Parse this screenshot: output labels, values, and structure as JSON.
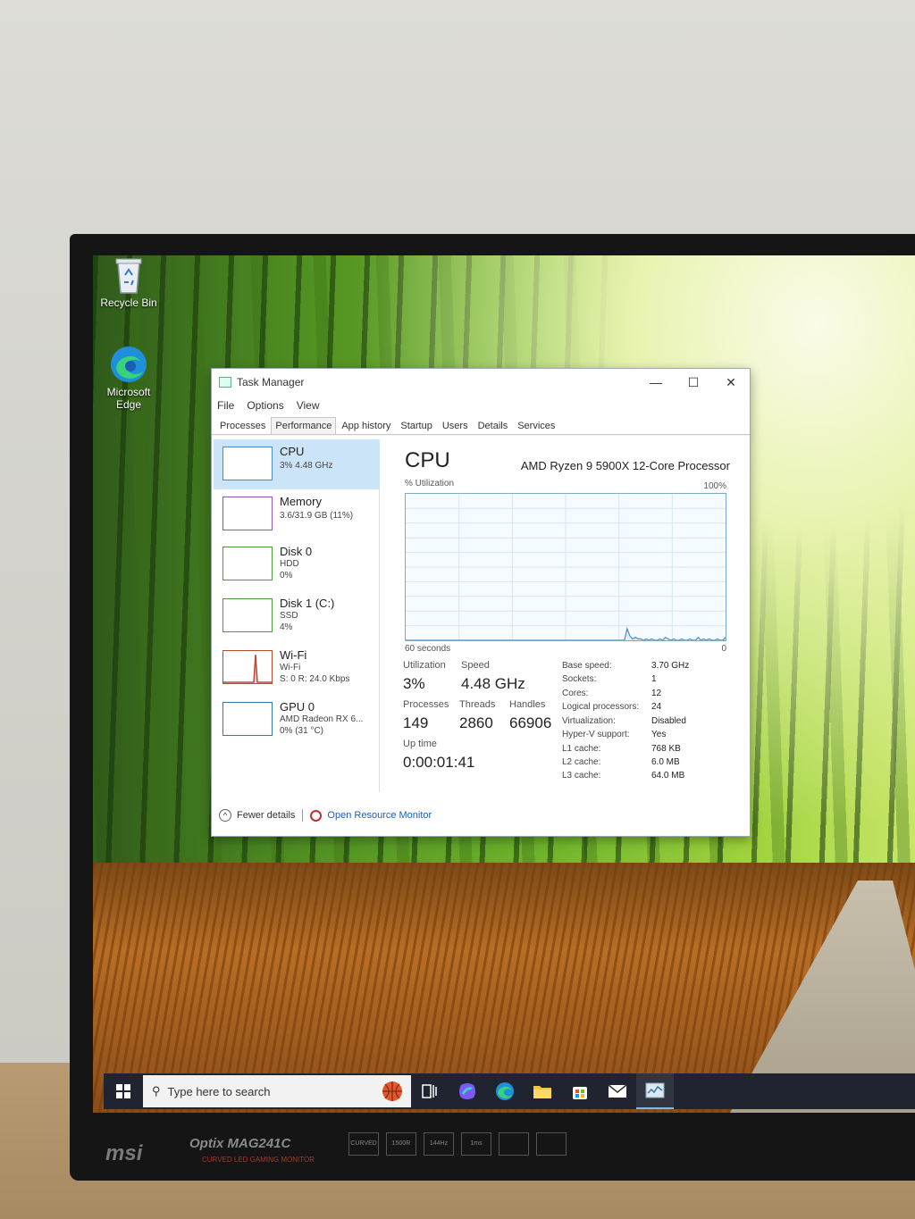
{
  "desktop": {
    "icons": [
      {
        "label": "Recycle Bin",
        "icon": "recycle-bin-icon"
      },
      {
        "label": "Microsoft Edge",
        "icon": "edge-icon"
      }
    ]
  },
  "window": {
    "title": "Task Manager",
    "controls": {
      "minimize": "—",
      "maximize": "☐",
      "close": "✕"
    }
  },
  "menu": [
    "File",
    "Options",
    "View"
  ],
  "tabs": [
    "Processes",
    "Performance",
    "App history",
    "Startup",
    "Users",
    "Details",
    "Services"
  ],
  "active_tab": "Performance",
  "sidebar": [
    {
      "name": "CPU",
      "line1": "3% 4.48 GHz",
      "line2": ""
    },
    {
      "name": "Memory",
      "line1": "3.6/31.9 GB (11%)",
      "line2": ""
    },
    {
      "name": "Disk 0",
      "line1": "HDD",
      "line2": "0%"
    },
    {
      "name": "Disk 1 (C:)",
      "line1": "SSD",
      "line2": "4%"
    },
    {
      "name": "Wi-Fi",
      "line1": "Wi-Fi",
      "line2": "S: 0 R: 24.0 Kbps"
    },
    {
      "name": "GPU 0",
      "line1": "AMD Radeon RX 6...",
      "line2": "0% (31 °C)"
    }
  ],
  "cpu": {
    "title": "CPU",
    "model": "AMD Ryzen 9 5900X 12-Core Processor",
    "util_label": "% Utilization",
    "util_max": "100%",
    "time_span": "60 seconds",
    "zero": "0",
    "graph_points": [
      0,
      0,
      0,
      0,
      0,
      0,
      0,
      0,
      0,
      0,
      0,
      0,
      0,
      0,
      0,
      0,
      0,
      0,
      0,
      0,
      0,
      0,
      0,
      0,
      0,
      0,
      0,
      0,
      0,
      0,
      0,
      0,
      0,
      0,
      0,
      0,
      0,
      0,
      0,
      0,
      0,
      0,
      0,
      0,
      0,
      0,
      0,
      0,
      0,
      0,
      0,
      0,
      0,
      0,
      0,
      0,
      0,
      0,
      0,
      0,
      0,
      0,
      0,
      0,
      0,
      0,
      0,
      0,
      0,
      0,
      0,
      0,
      0,
      0,
      0,
      0,
      0,
      0,
      0,
      0,
      0,
      8,
      3,
      1,
      2,
      1,
      1,
      0,
      1,
      0,
      1,
      0,
      0,
      1,
      0,
      2,
      1,
      0,
      1,
      0,
      0,
      1,
      0,
      0,
      1,
      0,
      0,
      2,
      0,
      1,
      0,
      1,
      0,
      0,
      1,
      0,
      0,
      2
    ]
  },
  "stats": {
    "utilization_label": "Utilization",
    "utilization": "3%",
    "speed_label": "Speed",
    "speed": "4.48 GHz",
    "processes_label": "Processes",
    "processes": "149",
    "threads_label": "Threads",
    "threads": "2860",
    "handles_label": "Handles",
    "handles": "66906",
    "uptime_label": "Up time",
    "uptime": "0:00:01:41"
  },
  "specs": [
    {
      "label": "Base speed:",
      "value": "3.70 GHz"
    },
    {
      "label": "Sockets:",
      "value": "1"
    },
    {
      "label": "Cores:",
      "value": "12"
    },
    {
      "label": "Logical processors:",
      "value": "24"
    },
    {
      "label": "Virtualization:",
      "value": "Disabled"
    },
    {
      "label": "Hyper-V support:",
      "value": "Yes"
    },
    {
      "label": "L1 cache:",
      "value": "768 KB"
    },
    {
      "label": "L2 cache:",
      "value": "6.0 MB"
    },
    {
      "label": "L3 cache:",
      "value": "64.0 MB"
    }
  ],
  "footer": {
    "fewer": "Fewer details",
    "resource_monitor": "Open Resource Monitor"
  },
  "taskbar": {
    "search_placeholder": "Type here to search",
    "icons": [
      "task-view-icon",
      "copilot-icon",
      "edge-icon",
      "file-explorer-icon",
      "store-icon",
      "mail-icon",
      "task-manager-icon"
    ]
  },
  "monitor": {
    "brand": "msi",
    "model": "Optix MAG241C",
    "subtitle": "CURVED LED GAMING MONITOR",
    "badges": [
      "CURVED",
      "1500R",
      "144Hz",
      "1ms",
      "",
      ""
    ]
  },
  "colors": {
    "selected": "#cce4f7",
    "graph_line": "#4a8db8",
    "link": "#1a5fb4"
  }
}
